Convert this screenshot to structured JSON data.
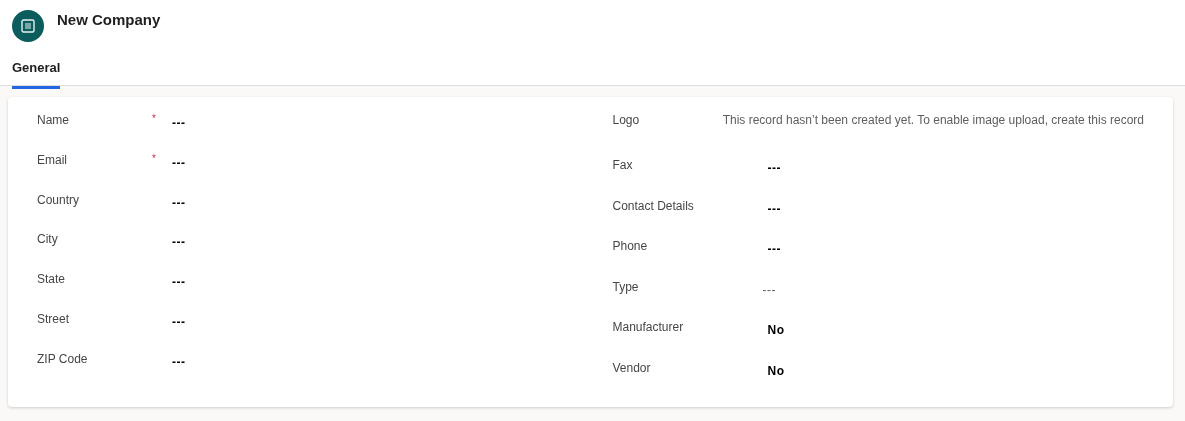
{
  "header": {
    "title": "New Company"
  },
  "tabs": [
    {
      "label": "General",
      "selected": true
    }
  ],
  "left_fields": [
    {
      "label": "Name",
      "required_mark": "*",
      "value": "---",
      "kind": "value"
    },
    {
      "label": "Email",
      "required_mark": "*",
      "value": "---",
      "kind": "value"
    },
    {
      "label": "Country",
      "value": "---",
      "kind": "value"
    },
    {
      "label": "City",
      "value": "---",
      "kind": "value"
    },
    {
      "label": "State",
      "value": "---",
      "kind": "value"
    },
    {
      "label": "Street",
      "value": "---",
      "kind": "value"
    },
    {
      "label": "ZIP Code",
      "value": "---",
      "kind": "value"
    }
  ],
  "right_fields": [
    {
      "label": "Logo",
      "value": "This record hasn’t been created yet. To enable image upload, create this record",
      "kind": "note"
    },
    {
      "label": "Fax",
      "value": "---",
      "kind": "value"
    },
    {
      "label": "Contact Details",
      "value": "---",
      "kind": "value"
    },
    {
      "label": "Phone",
      "value": "---",
      "kind": "value"
    },
    {
      "label": "Type",
      "value": "---",
      "kind": "muted"
    },
    {
      "label": "Manufacturer",
      "value": "No",
      "kind": "value"
    },
    {
      "label": "Vendor",
      "value": "No",
      "kind": "value"
    }
  ]
}
